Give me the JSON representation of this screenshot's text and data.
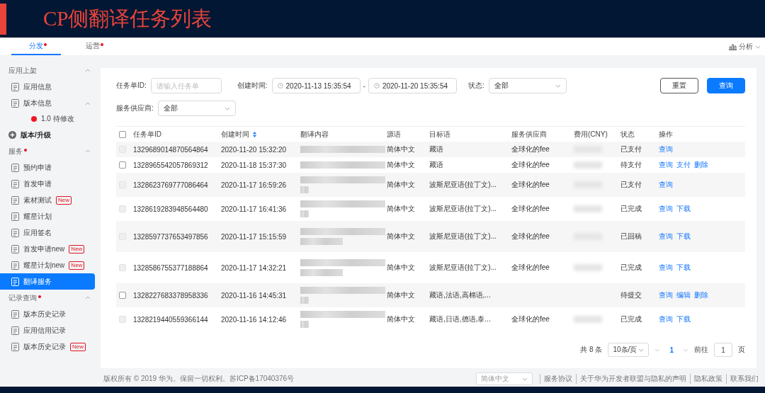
{
  "banner": {
    "title": "CP侧翻译任务列表"
  },
  "top_tabs": [
    {
      "label": "分发",
      "selected": true,
      "marked": true
    },
    {
      "label": "运营",
      "selected": false,
      "marked": true
    }
  ],
  "analysis_link": "分析",
  "sidebar": {
    "groups": [
      {
        "title": "应用上架",
        "marked": false,
        "expanded": true,
        "items": [
          {
            "label": "应用信息",
            "selected": false
          },
          {
            "label": "版本信息",
            "selected": false,
            "expanded": true,
            "children": [
              {
                "label": "1.0 待修改",
                "color": "#f0161f"
              }
            ]
          }
        ]
      },
      {
        "title": "版本/升级",
        "kind": "action"
      },
      {
        "title": "服务",
        "marked": true,
        "expanded": true,
        "items": [
          {
            "label": "预约申请",
            "selected": false
          },
          {
            "label": "首发申请",
            "selected": false
          },
          {
            "label": "素材测试",
            "badge": "New",
            "selected": false
          },
          {
            "label": "耀星计划",
            "selected": false
          },
          {
            "label": "应用签名",
            "selected": false
          },
          {
            "label": "首发申请new",
            "badge": "New",
            "selected": false
          },
          {
            "label": "耀星计划new",
            "badge": "New",
            "selected": false
          },
          {
            "label": "翻译服务",
            "selected": true
          }
        ]
      },
      {
        "title": "记录查询",
        "marked": true,
        "expanded": true,
        "items": [
          {
            "label": "版本历史记录",
            "selected": false
          },
          {
            "label": "应用信用记录",
            "selected": false
          },
          {
            "label": "版本历史记录",
            "badge": "New",
            "selected": false
          }
        ]
      }
    ]
  },
  "filters": {
    "task_id": {
      "label": "任务单ID:",
      "placeholder": "请输入任务单"
    },
    "created": {
      "label": "创建时间:",
      "from": "2020-11-13 15:35:54",
      "separator": "-",
      "to": "2020-11-20 15:35:54"
    },
    "status": {
      "label": "状态:",
      "value": "全部"
    },
    "provider": {
      "label": "服务供应商:",
      "value": "全部"
    },
    "buttons": [
      {
        "label": "重置",
        "kind": "secondary"
      },
      {
        "label": "查询",
        "kind": "primary"
      }
    ]
  },
  "table": {
    "select_all_checked": false,
    "columns": [
      {
        "label": "任务单ID"
      },
      {
        "label": "创建时间",
        "sortable": true
      },
      {
        "label": "翻译内容"
      },
      {
        "label": "源语"
      },
      {
        "label": "目标语"
      },
      {
        "label": "服务供应商"
      },
      {
        "label": "费用(CNY)"
      },
      {
        "label": "状态"
      },
      {
        "label": "操作"
      }
    ],
    "rows": [
      {
        "disabled": true,
        "id": "1329689014870564864",
        "created": "2020-11-20 15:32:20",
        "kind": "single",
        "source": "简体中文",
        "target": "藏语",
        "provider": "全球化的fee",
        "fee_redacted": true,
        "status": "已支付",
        "actions": [
          "查询"
        ]
      },
      {
        "disabled": false,
        "id": "1328965542057869312",
        "created": "2020-11-18 15:37:30",
        "kind": "single",
        "source": "简体中文",
        "target": "藏语",
        "provider": "全球化的fee",
        "fee_redacted": true,
        "status": "待支付",
        "actions": [
          "查询",
          "支付",
          "删除"
        ]
      },
      {
        "disabled": true,
        "id": "1328623769777086464",
        "created": "2020-11-17 16:59:26",
        "kind": "double",
        "source": "简体中文",
        "target": "波斯尼亚语(拉丁文)...",
        "provider": "全球化的fee",
        "fee_redacted": true,
        "status": "已支付",
        "actions": [
          "查询"
        ]
      },
      {
        "disabled": true,
        "id": "1328619283948564480",
        "created": "2020-11-17 16:41:36",
        "kind": "double",
        "source": "简体中文",
        "target": "波斯尼亚语(拉丁文)...",
        "provider": "全球化的fee",
        "fee_redacted": true,
        "status": "已完成",
        "actions": [
          "查询",
          "下载"
        ]
      },
      {
        "disabled": true,
        "id": "1328597737653497856",
        "created": "2020-11-17 15:15:59",
        "kind": "triple",
        "source": "简体中文",
        "target": "波斯尼亚语(拉丁文)...",
        "provider": "全球化的fee",
        "fee_redacted": true,
        "status": "已回稿",
        "actions": [
          "查询",
          "下载"
        ]
      },
      {
        "disabled": true,
        "id": "1328586755377188864",
        "created": "2020-11-17 14:32:21",
        "kind": "triple",
        "source": "简体中文",
        "target": "波斯尼亚语(拉丁文)...",
        "provider": "全球化的fee",
        "fee_redacted": true,
        "status": "已完成",
        "actions": [
          "查询",
          "下载"
        ]
      },
      {
        "disabled": false,
        "id": "1328227683378958336",
        "created": "2020-11-16 14:45:31",
        "kind": "double",
        "source": "简体中文",
        "target": "藏语,法语,高棉语,...",
        "fee_redacted": false,
        "status": "待提交",
        "actions": [
          "查询",
          "编辑",
          "删除"
        ]
      },
      {
        "disabled": true,
        "id": "1328219440559366144",
        "created": "2020-11-16 14:12:46",
        "kind": "double",
        "source": "简体中文",
        "target": "藏语,日语,德语,泰...",
        "provider": "全球化的fee",
        "fee_redacted": true,
        "status": "已完成",
        "actions": [
          "查询",
          "下载"
        ]
      }
    ]
  },
  "pagination": {
    "total": "共 8 条",
    "page_size": "10条/页",
    "pages": [
      {
        "label": "1",
        "selected": true
      }
    ],
    "goto_label": "前往",
    "goto_value": "1",
    "goto_suffix": "页"
  },
  "footer": {
    "copyright": "版权所有 © 2019 华为。保留一切权利。苏ICP备17040376号",
    "language": "简体中文",
    "links": [
      "服务协议",
      "关于华为开发者联盟与隐私的声明",
      "隐私政策",
      "联系我们"
    ]
  }
}
